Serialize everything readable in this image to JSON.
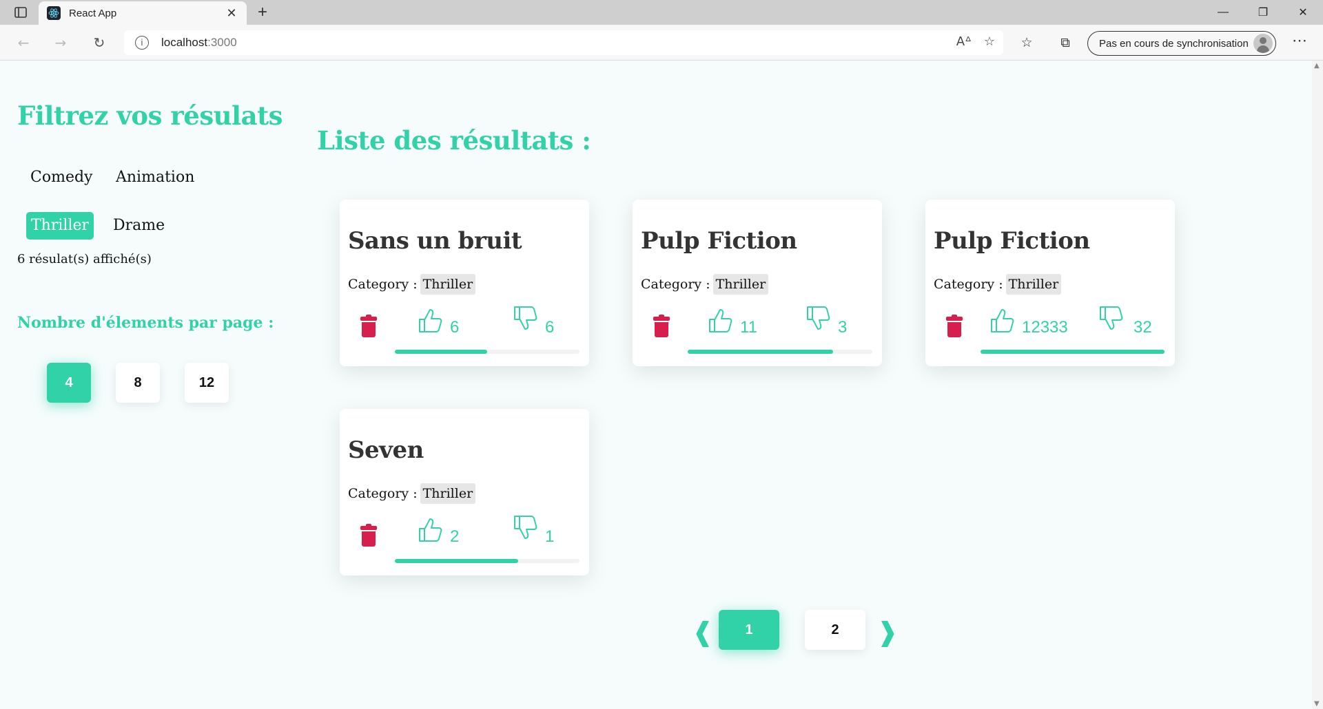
{
  "browser": {
    "tab_title": "React App",
    "tab_close": "✕",
    "new_tab": "+",
    "url_host": "localhost",
    "url_port": ":3000",
    "sync_label": "Pas en cours de synchronisation",
    "more": "⋯"
  },
  "sidebar": {
    "title": "Filtrez vos résulats",
    "filters": [
      {
        "label": "Comedy",
        "active": false
      },
      {
        "label": "Animation",
        "active": false
      },
      {
        "label": "Thriller",
        "active": true
      },
      {
        "label": "Drame",
        "active": false
      }
    ],
    "result_count": "6 résulat(s) affiché(s)",
    "per_page_title": "Nombre d'élements par page :",
    "per_page_options": [
      {
        "label": "4",
        "active": true
      },
      {
        "label": "8",
        "active": false
      },
      {
        "label": "12",
        "active": false
      }
    ]
  },
  "main": {
    "title": "Liste des résultats :",
    "category_label": "Category :",
    "movies": [
      {
        "title": "Sans un bruit",
        "category": "Thriller",
        "likes": "6",
        "dislikes": "6",
        "like_ratio": 0.5
      },
      {
        "title": "Pulp Fiction",
        "category": "Thriller",
        "likes": "11",
        "dislikes": "3",
        "like_ratio": 0.786
      },
      {
        "title": "Pulp Fiction",
        "category": "Thriller",
        "likes": "12333",
        "dislikes": "32",
        "like_ratio": 0.997
      },
      {
        "title": "Seven",
        "category": "Thriller",
        "likes": "2",
        "dislikes": "1",
        "like_ratio": 0.667
      }
    ]
  },
  "pagination": {
    "prev": "❰",
    "next": "❱",
    "pages": [
      {
        "label": "1",
        "active": true
      },
      {
        "label": "2",
        "active": false
      }
    ]
  },
  "colors": {
    "accent": "#31d2a8",
    "delete": "#d81e4d",
    "page_bg": "#f6fcfc"
  }
}
